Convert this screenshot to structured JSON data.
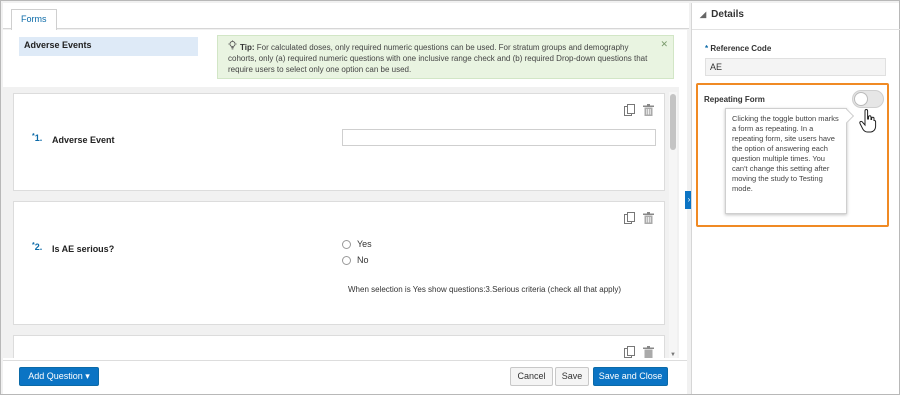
{
  "tabs": [
    {
      "label": "Forms"
    }
  ],
  "form": {
    "name": "Adverse Events"
  },
  "tip": {
    "label": "Tip:",
    "text": "For calculated doses, only required numeric questions can be used. For stratum groups and demography cohorts, only (a) required numeric questions with one inclusive range check and (b) required Drop-down questions that require users to select only one option can be used.",
    "close_icon": "✕"
  },
  "questions": [
    {
      "number": "1.",
      "required": "*",
      "label": "Adverse Event",
      "type": "text",
      "value": ""
    },
    {
      "number": "2.",
      "required": "*",
      "label": "Is AE serious?",
      "type": "radio",
      "options": [
        "Yes",
        "No"
      ],
      "note": "When selection is Yes show questions:3.Serious criteria (check all that apply)"
    }
  ],
  "icons": {
    "copy": "copy-icon",
    "delete": "trash-icon"
  },
  "footer": {
    "add_question": "Add Question",
    "cancel": "Cancel",
    "save": "Save",
    "save_close": "Save and Close"
  },
  "details": {
    "title": "Details",
    "reference_code_label": "Reference Code",
    "reference_code_value": "AE",
    "repeating_form_label": "Repeating Form",
    "repeating_form_on": false,
    "tooltip": "Clicking the toggle button marks a form as repeating. In a repeating form, site users have the option of answering each question multiple times. You can't change this setting after moving the study to Testing mode."
  },
  "colors": {
    "accent": "#0b74c4",
    "highlight": "#f08a24",
    "tip_bg": "#e9f4e1"
  }
}
